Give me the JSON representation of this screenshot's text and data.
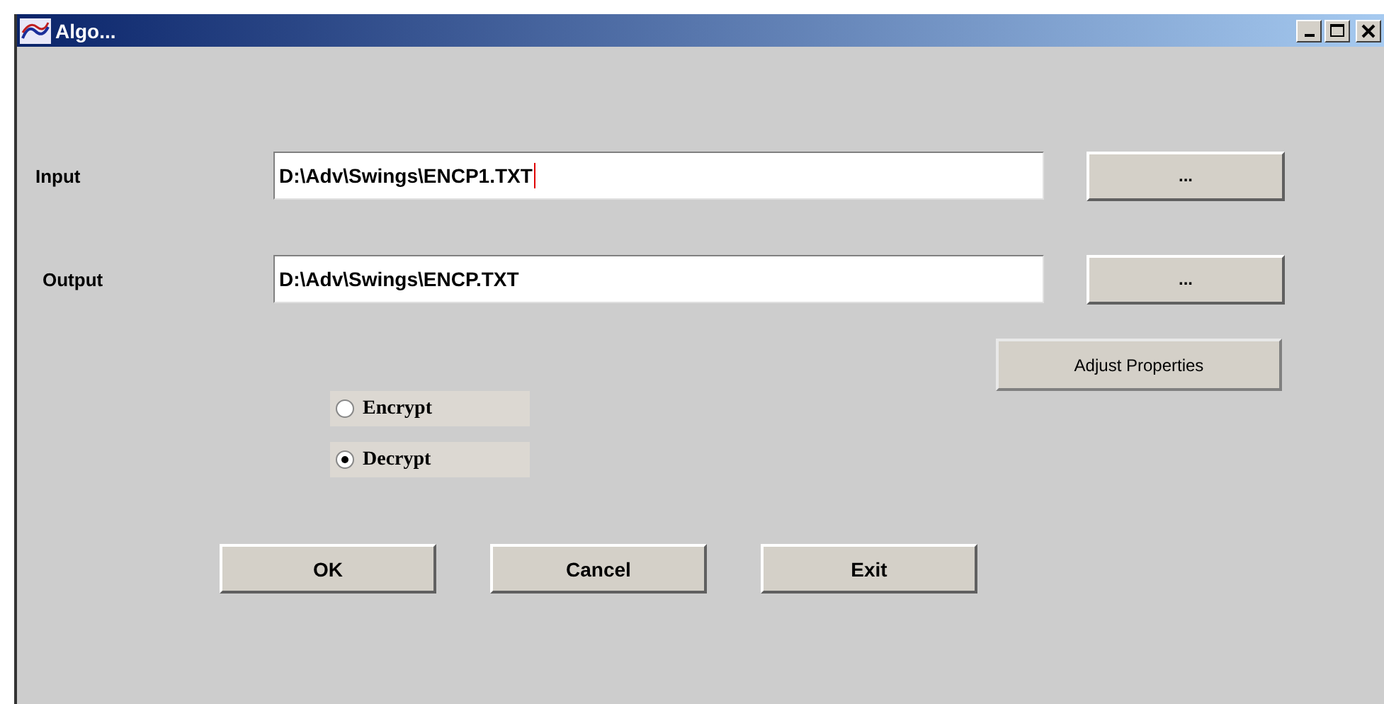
{
  "window": {
    "title": "Algo..."
  },
  "fields": [
    {
      "label": "Input",
      "value": "D:\\Adv\\Swings\\ENCP1.TXT",
      "focused": true,
      "button": "..."
    },
    {
      "label": "Output",
      "value": "D:\\Adv\\Swings\\ENCP.TXT",
      "focused": false,
      "button": "..."
    }
  ],
  "adjust_button": "Adjust Properties",
  "modes": [
    {
      "label": "Encrypt",
      "selected": false
    },
    {
      "label": "Decrypt",
      "selected": true
    }
  ],
  "buttons": [
    "OK",
    "Cancel",
    "Exit"
  ]
}
